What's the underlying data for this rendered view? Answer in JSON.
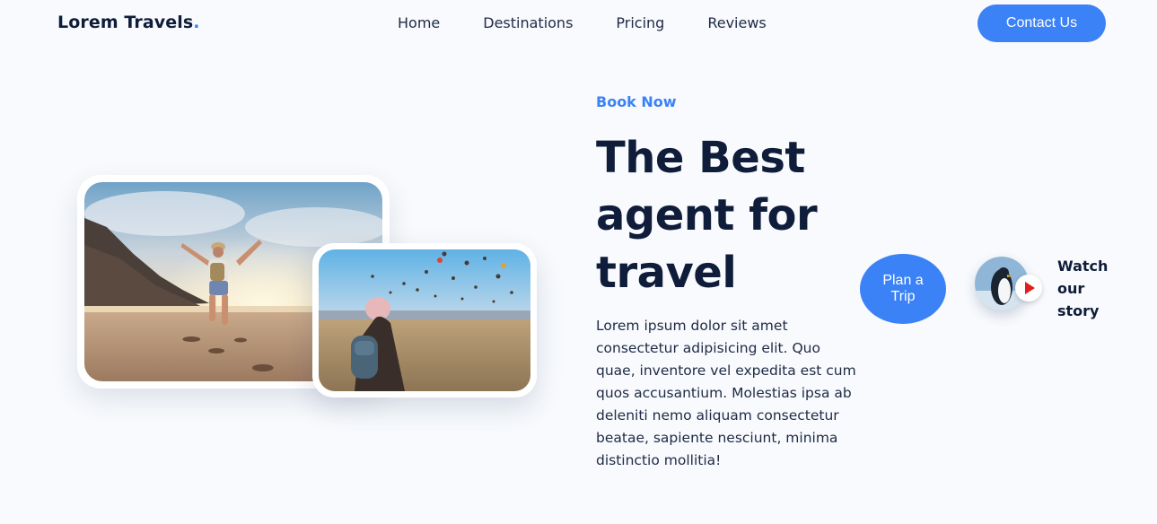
{
  "header": {
    "logo_text": "Lorem Travels",
    "logo_dot": ".",
    "nav": [
      "Home",
      "Destinations",
      "Pricing",
      "Reviews"
    ],
    "contact_label": "Contact Us"
  },
  "hero": {
    "eyebrow": "Book Now",
    "headline": "The Best agent for travel",
    "description": "Lorem ipsum dolor sit amet consectetur adipisicing elit. Quo quae, inventore vel expedita est cum quos accusantium. Molestias ipsa ab deleniti nemo aliquam consectetur beatae, sapiente nesciunt, minima distinctio mollitia!",
    "plan_label": "Plan a Trip",
    "watch_label": "Watch our story"
  },
  "colors": {
    "accent": "#3b82f6",
    "heading": "#0f1d3a",
    "background": "#f8fafd",
    "play_icon": "#e11d1d"
  },
  "icons": {
    "play": "play-icon"
  }
}
